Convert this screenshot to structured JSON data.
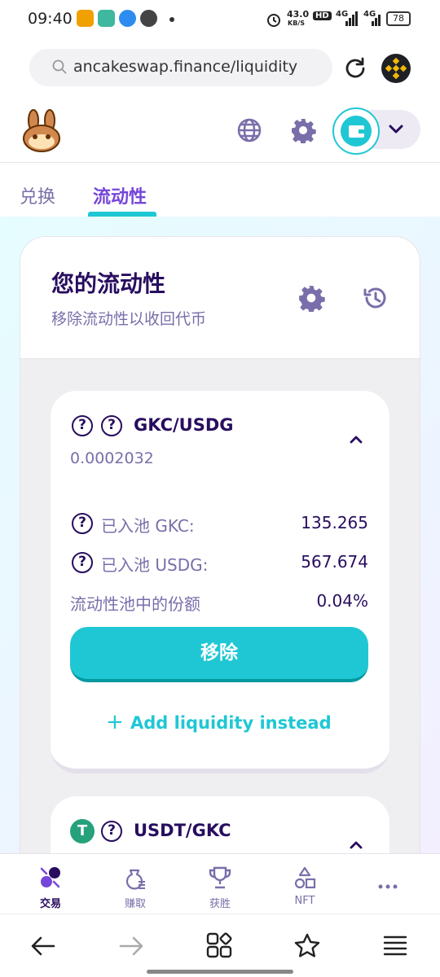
{
  "status_bar": {
    "time": "09:40",
    "net_speed": "43.0",
    "net_unit": "KB/S",
    "hd": "HD",
    "net1": "4G",
    "net2": "4G",
    "battery": "78"
  },
  "browser": {
    "url": "ancakeswap.finance/liquidity"
  },
  "tabs": {
    "swap": "兑换",
    "liquidity": "流动性"
  },
  "liquidity": {
    "title": "您的流动性",
    "subtitle": "移除流动性以收回代币"
  },
  "pools": [
    {
      "pair": "GKC/USDG",
      "amount": "0.0002032",
      "rows": [
        {
          "label": "已入池 GKC:",
          "value": "135.265"
        },
        {
          "label": "已入池 USDG:",
          "value": "567.674"
        },
        {
          "label": "流动性池中的份额",
          "value": "0.04%"
        }
      ],
      "remove_label": "移除",
      "add_label": "Add liquidity instead"
    },
    {
      "pair": "USDT/GKC"
    }
  ],
  "question_mark": "?",
  "usdt_symbol": "T",
  "bottom_nav": [
    {
      "label": "交易",
      "icon": "trade-icon",
      "active": true
    },
    {
      "label": "赚取",
      "icon": "earn-icon",
      "active": false
    },
    {
      "label": "获胜",
      "icon": "trophy-icon",
      "active": false
    },
    {
      "label": "NFT",
      "icon": "nft-icon",
      "active": false
    },
    {
      "label": "",
      "icon": "more-icon",
      "active": false
    }
  ],
  "colors": {
    "primary": "#1fc7d4",
    "text": "#280d5f",
    "secondary_text": "#7a6eaa",
    "accent": "#7645d9"
  }
}
